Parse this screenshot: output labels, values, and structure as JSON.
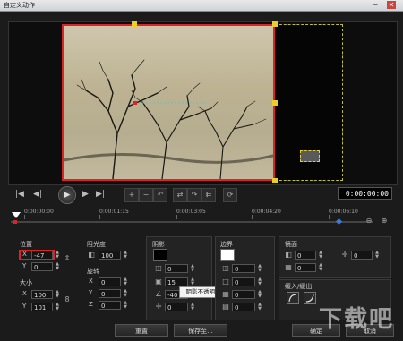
{
  "window": {
    "title": "自定义动作",
    "minimize": "─",
    "close": "✕"
  },
  "preview": {
    "timecode": "0:00:00:00"
  },
  "transport": {
    "icons": [
      "skip-start-icon",
      "step-back-icon",
      "play-icon",
      "step-forward-icon",
      "skip-end-icon"
    ],
    "glyphs": {
      "start": "|◀",
      "back": "◀|",
      "play": "▶",
      "fwd": "|▶",
      "end": "▶|"
    }
  },
  "tools": {
    "glyphs": [
      "+",
      "−",
      "↶",
      "⇄",
      "↷",
      "⇇",
      "⟳"
    ]
  },
  "timeline": {
    "ticks": [
      "0:00:00:00",
      "0:00:01:15",
      "0:00:03:05",
      "0:00:04:20",
      "0:00:06:10"
    ]
  },
  "zoom": {
    "out": "⊖",
    "in": "⊕"
  },
  "position": {
    "label": "位置",
    "x_label": "X",
    "x_value": "-47",
    "y_label": "Y",
    "y_value": "0"
  },
  "size": {
    "label": "大小",
    "x_label": "X",
    "x_value": "100",
    "y_label": "Y",
    "y_value": "101"
  },
  "opacity": {
    "label": "阻光度",
    "value": "100"
  },
  "rotation": {
    "label": "旋转",
    "x_label": "X",
    "x_value": "0",
    "y_label": "Y",
    "y_value": "0",
    "z_label": "Z",
    "z_value": "0"
  },
  "shadow": {
    "label": "阴影",
    "value1": "0",
    "value2": "15",
    "value3": "-40",
    "value4": "0",
    "tooltip": "阴影不透明度"
  },
  "border": {
    "label": "边界",
    "value1": "0",
    "value2": "0",
    "value3": "0",
    "value4": "0"
  },
  "mirror": {
    "label": "镜面",
    "value1": "0",
    "value2": "0",
    "value3": "0",
    "value4": "0"
  },
  "fade": {
    "label": "缓入/缓出"
  },
  "buttons": {
    "reset": "重置",
    "save_to": "保存至...",
    "ok": "确定",
    "cancel": "取消"
  },
  "watermark": {
    "text": "下载吧"
  },
  "colors": {
    "accent_red": "#d9252a",
    "handle_yellow": "#e8d02a"
  }
}
